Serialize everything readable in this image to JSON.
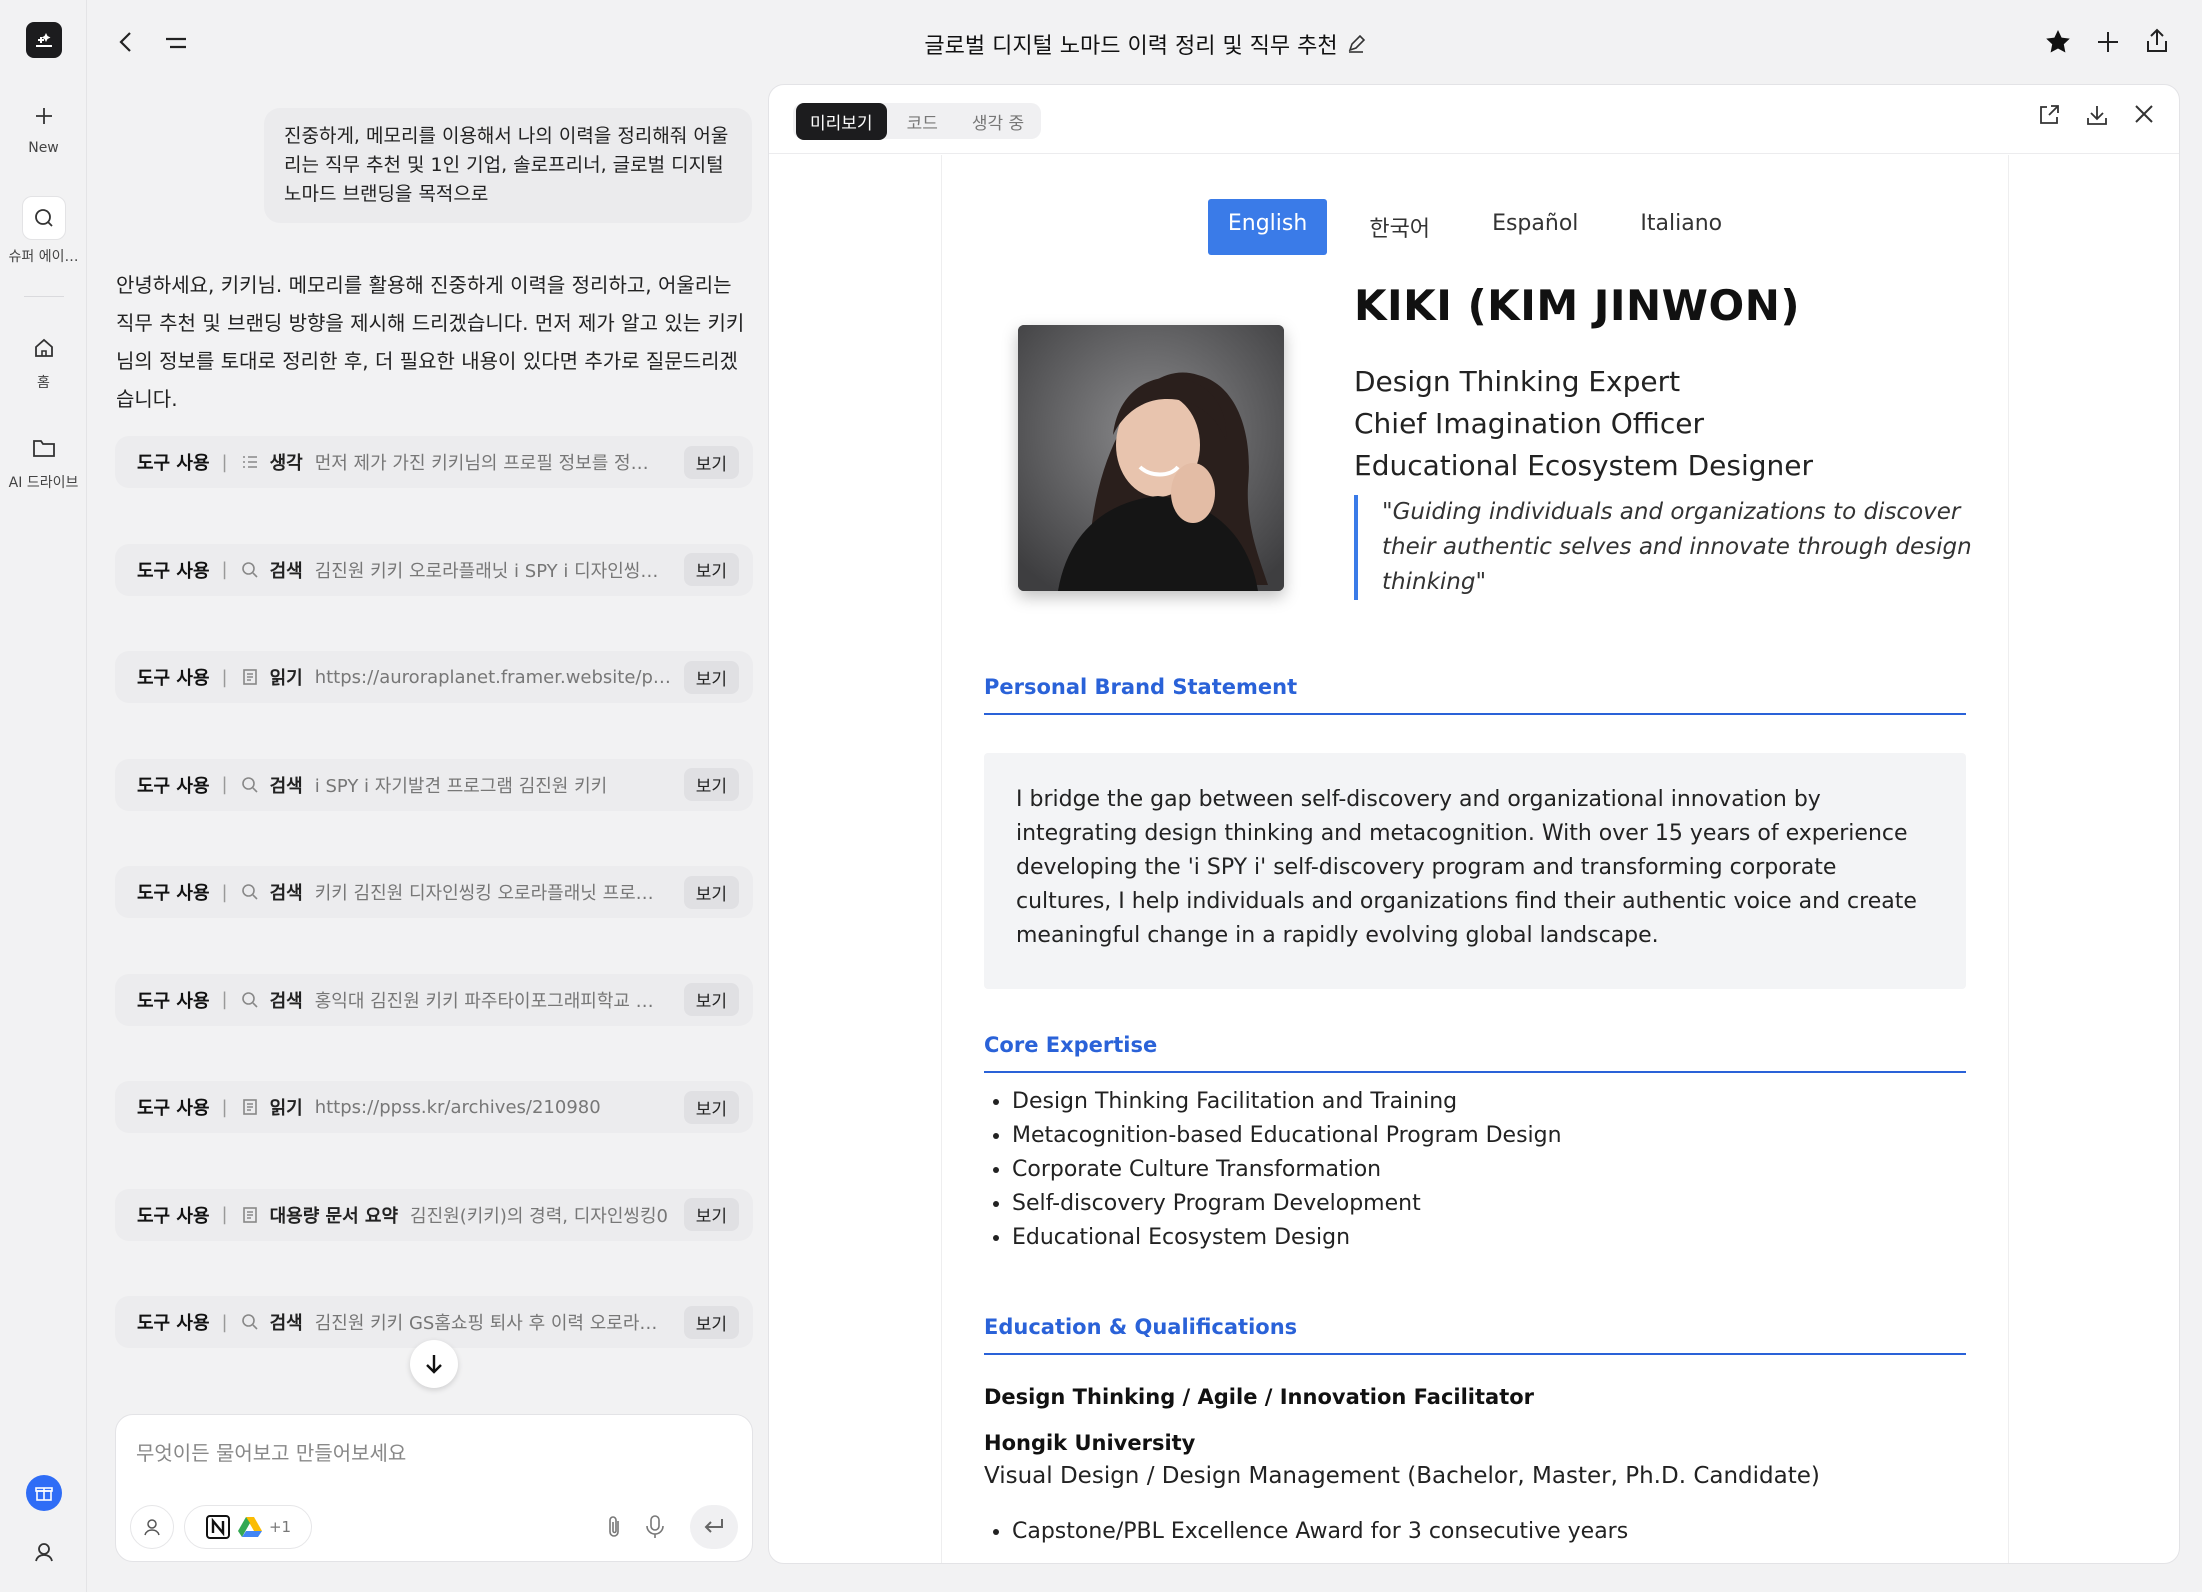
{
  "rail": {
    "new_label": "New",
    "super_agent_label": "슈퍼 에이…",
    "home_label": "홈",
    "drive_label": "AI 드라이브"
  },
  "header": {
    "title": "글로벌 디지털 노마드 이력 정리 및 직무 추천"
  },
  "chat": {
    "user_message": "진중하게, 메모리를 이용해서 나의 이력을 정리해줘 어울리는 직무 추천 및 1인 기업, 솔로프리너, 글로벌 디지털 노마드 브랜딩을 목적으로",
    "assistant_message": "안녕하세요, 키키님. 메모리를 활용해 진중하게 이력을 정리하고, 어울리는 직무 추천 및 브랜딩 방향을 제시해 드리겠습니다. 먼저 제가 알고 있는 키키님의 정보를 토대로 정리한 후, 더 필요한 내용이 있다면 추가로 질문드리겠습니다.",
    "tool_label": "도구 사용",
    "view_label": "보기",
    "tools": [
      {
        "kind": "생각",
        "icon": "list-icon",
        "desc": "먼저 제가 가진 키키님의 프로필 정보를 정…"
      },
      {
        "kind": "검색",
        "icon": "search-icon",
        "desc": "김진원 키키 오로라플래닛 i SPY i 디자인씽…"
      },
      {
        "kind": "읽기",
        "icon": "document-icon",
        "desc": "https://auroraplanet.framer.website/p…"
      },
      {
        "kind": "검색",
        "icon": "search-icon",
        "desc": "i SPY i 자기발견 프로그램 김진원 키키"
      },
      {
        "kind": "검색",
        "icon": "search-icon",
        "desc": "키키 김진원 디자인씽킹 오로라플래닛 프로…"
      },
      {
        "kind": "검색",
        "icon": "search-icon",
        "desc": "홍익대 김진원 키키 파주타이포그래피학교 …"
      },
      {
        "kind": "읽기",
        "icon": "document-icon",
        "desc": "https://ppss.kr/archives/210980"
      },
      {
        "kind": "대용량 문서 요약",
        "icon": "document-icon",
        "desc": "김진원(키키)의 경력, 디자인씽킹0"
      },
      {
        "kind": "검색",
        "icon": "search-icon",
        "desc": "김진원 키키 GS홈쇼핑 퇴사 후 이력 오로라…"
      }
    ],
    "composer_placeholder": "무엇이든 물어보고 만들어보세요",
    "integrations_more": "+1"
  },
  "panel": {
    "tabs": [
      "미리보기",
      "코드",
      "생각 중"
    ],
    "active_tab": 0
  },
  "resume": {
    "languages": [
      "English",
      "한국어",
      "Español",
      "Italiano"
    ],
    "active_language": 0,
    "name": "KIKI (KIM JINWON)",
    "roles": [
      "Design Thinking Expert",
      "Chief Imagination Officer",
      "Educational Ecosystem Designer"
    ],
    "quote": "\"Guiding individuals and organizations to discover their authentic selves and innovate through design thinking\"",
    "brand_title": "Personal Brand Statement",
    "brand_text": "I bridge the gap between self-discovery and organizational innovation by integrating design thinking and metacognition. With over 15 years of experience developing the 'i SPY i' self-discovery program and transforming corporate cultures, I help individuals and organizations find their authentic voice and create meaningful change in a rapidly evolving global landscape.",
    "expertise_title": "Core Expertise",
    "expertise": [
      "Design Thinking Facilitation and Training",
      "Metacognition-based Educational Program Design",
      "Corporate Culture Transformation",
      "Self-discovery Program Development",
      "Educational Ecosystem Design"
    ],
    "education_title": "Education & Qualifications",
    "education_role": "Design Thinking / Agile / Innovation Facilitator",
    "university": "Hongik University",
    "degree": "Visual Design / Design Management (Bachelor, Master, Ph.D. Candidate)",
    "award": "Capstone/PBL Excellence Award for 3 consecutive years"
  },
  "colors": {
    "accent": "#2a62d8",
    "lang_active": "#3a7be8",
    "dark": "#1c1c1e"
  }
}
